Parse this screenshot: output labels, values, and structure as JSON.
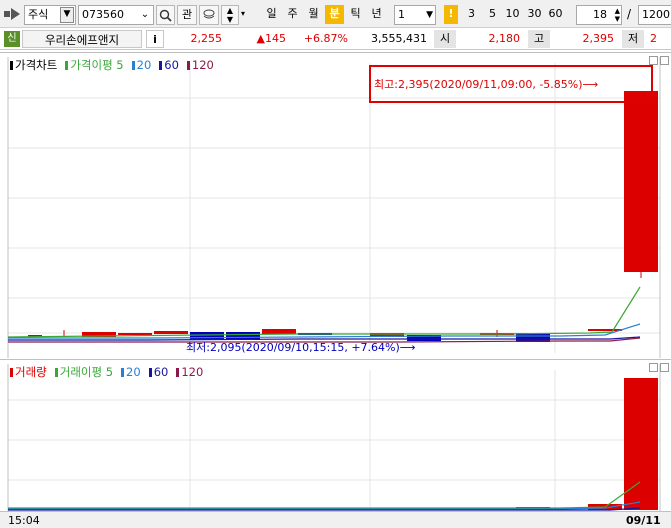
{
  "toolbar": {
    "market": "주식",
    "code": "073560",
    "watch_label": "관",
    "periods": [
      "일",
      "주",
      "월",
      "분",
      "틱",
      "년"
    ],
    "active_period": "분",
    "interval_value": "1",
    "interval_marker": "!",
    "interval_buttons": [
      "3",
      "5",
      "10",
      "30",
      "60"
    ],
    "count_value": "18",
    "slash": "/",
    "total_value": "1200"
  },
  "quote": {
    "badge": "신",
    "name": "우리손에프앤지",
    "info_label": "i",
    "price": "2,255",
    "change": "▲145",
    "change_pct": "+6.87%",
    "volume": "3,555,431",
    "open_label": "시",
    "open": "2,180",
    "high_label": "고",
    "high": "2,395",
    "low_label": "저",
    "low": "2"
  },
  "price_pane": {
    "legend": [
      {
        "label": "가격차트",
        "color": "#000000"
      },
      {
        "label": "가격이평 5",
        "color": "#39a839"
      },
      {
        "label": "20",
        "color": "#2a7fd4"
      },
      {
        "label": "60",
        "color": "#16169c"
      },
      {
        "label": "120",
        "color": "#8b1a4a"
      }
    ],
    "max_annotation": "최고:2,395(2020/09/11,09:00, -5.85%)⟶",
    "min_annotation": "최저:2,095(2020/09/10,15:15, +7.64%)⟶"
  },
  "volume_pane": {
    "legend": [
      {
        "label": "거래량",
        "color": "#dd0000"
      },
      {
        "label": "거래이평 5",
        "color": "#39a839"
      },
      {
        "label": "20",
        "color": "#2a7fd4"
      },
      {
        "label": "60",
        "color": "#16169c"
      },
      {
        "label": "120",
        "color": "#8b1a4a"
      }
    ]
  },
  "axis": {
    "start_label": "15:04",
    "end_label": "09/11"
  },
  "colors": {
    "up": "#dd0000",
    "down": "#0000bb",
    "ma5": "#39a839",
    "ma20": "#2a7fd4",
    "ma60": "#16169c",
    "ma120": "#8b1a4a",
    "highlight_box": "#e00000",
    "active_period_bg": "#f5b800"
  }
}
